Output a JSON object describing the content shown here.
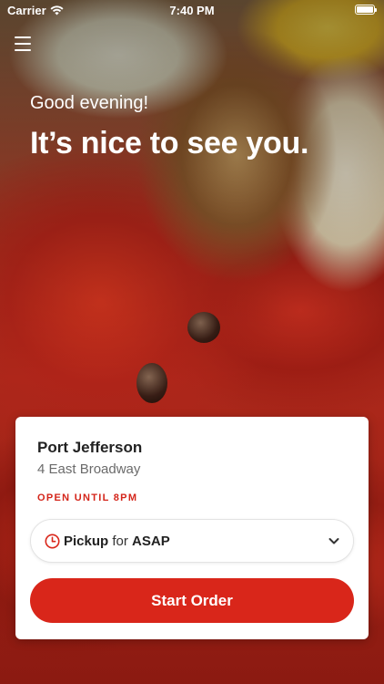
{
  "status_bar": {
    "carrier": "Carrier",
    "time": "7:40 PM",
    "battery_level": 1.0
  },
  "header": {
    "menu_icon": "hamburger-menu-icon"
  },
  "greeting": {
    "subtitle": "Good evening!",
    "title": "It’s nice to see you."
  },
  "location": {
    "name": "Port Jefferson",
    "address": "4 East Broadway",
    "hours": "OPEN UNTIL 8PM"
  },
  "order_options": {
    "mode": "Pickup",
    "connector": "for",
    "time": "ASAP",
    "icon": "clock-icon",
    "dropdown_icon": "chevron-down-icon"
  },
  "actions": {
    "start_order_label": "Start Order"
  },
  "colors": {
    "accent": "#d9261a",
    "hours_text": "#d4251a",
    "card_bg": "#ffffff"
  }
}
